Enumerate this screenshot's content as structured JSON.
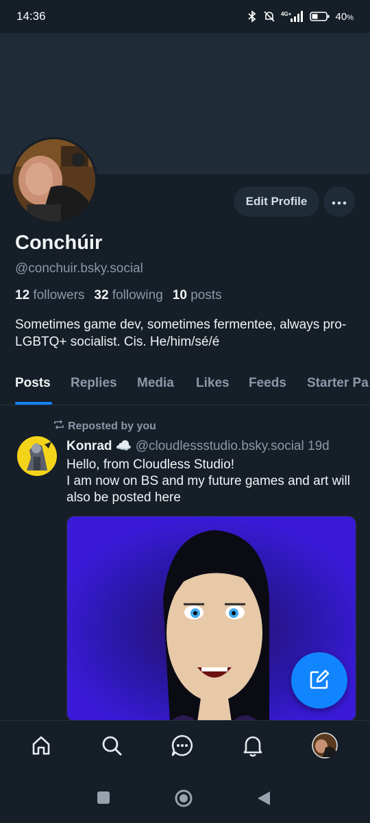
{
  "status_bar": {
    "time": "14:36",
    "battery": "40",
    "battery_unit": "%",
    "network": "4G+",
    "icons": [
      "bluetooth-icon",
      "muted-bell-icon",
      "signal-icon",
      "battery-icon"
    ]
  },
  "profile": {
    "display_name": "Conchúir",
    "handle": "@conchuir.bsky.social",
    "followers_count": "12",
    "followers_label": "followers",
    "following_count": "32",
    "following_label": "following",
    "posts_count": "10",
    "posts_label": "posts",
    "bio": "Sometimes game dev, sometimes fermentee, always pro-LGBTQ+ socialist. Cis. He/him/sé/é",
    "edit_button": "Edit Profile",
    "more_icon": "more-icon"
  },
  "tabs": [
    {
      "label": "Posts",
      "active": true
    },
    {
      "label": "Replies",
      "active": false
    },
    {
      "label": "Media",
      "active": false
    },
    {
      "label": "Likes",
      "active": false
    },
    {
      "label": "Feeds",
      "active": false
    },
    {
      "label": "Starter Pa",
      "active": false
    }
  ],
  "post": {
    "repost_label": "Reposted by you",
    "author": "Konrad ☁️",
    "handle": "@cloudlessstudio.bsky.social",
    "time": "19d",
    "text_line1": "Hello, from Cloudless Studio!",
    "text_line2": "I am now on BS and my future games and art will also be posted here"
  },
  "colors": {
    "background": "#161e27",
    "banner": "#1f2b37",
    "accent": "#1185fe",
    "muted_text": "#8b98a8",
    "image_bg": "#3a1ad8"
  },
  "bottom_nav": [
    "home-icon",
    "search-icon",
    "chat-icon",
    "notifications-icon",
    "profile-avatar"
  ],
  "system_nav": [
    "recents-button",
    "home-button",
    "back-button"
  ]
}
